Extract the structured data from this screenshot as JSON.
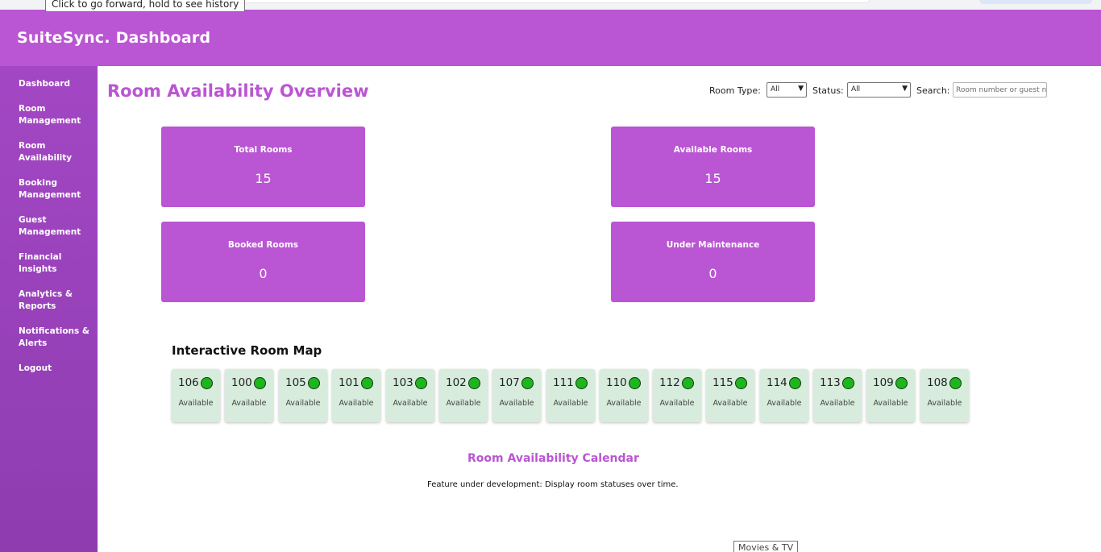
{
  "browser": {
    "tooltip": "Click to go forward, hold to see history"
  },
  "header": {
    "title": "SuiteSync. Dashboard"
  },
  "sidebar": {
    "items": [
      {
        "label": "Dashboard"
      },
      {
        "label": "Room Management"
      },
      {
        "label": "Room Availability"
      },
      {
        "label": "Booking Management"
      },
      {
        "label": "Guest Management"
      },
      {
        "label": "Financial Insights"
      },
      {
        "label": "Analytics & Reports"
      },
      {
        "label": "Notifications & Alerts"
      },
      {
        "label": "Logout"
      }
    ]
  },
  "main": {
    "title": "Room Availability Overview",
    "filters": {
      "room_type_label": "Room Type:",
      "room_type_value": "All",
      "status_label": "Status:",
      "status_value": "All",
      "search_label": "Search:",
      "search_placeholder": "Room number or guest name"
    },
    "stats": [
      {
        "label": "Total Rooms",
        "value": "15"
      },
      {
        "label": "Available Rooms",
        "value": "15"
      },
      {
        "label": "Booked Rooms",
        "value": "0"
      },
      {
        "label": "Under Maintenance",
        "value": "0"
      }
    ],
    "room_map": {
      "title": "Interactive Room Map",
      "rooms": [
        {
          "number": "106",
          "status": "Available"
        },
        {
          "number": "100",
          "status": "Available"
        },
        {
          "number": "105",
          "status": "Available"
        },
        {
          "number": "101",
          "status": "Available"
        },
        {
          "number": "103",
          "status": "Available"
        },
        {
          "number": "102",
          "status": "Available"
        },
        {
          "number": "107",
          "status": "Available"
        },
        {
          "number": "111",
          "status": "Available"
        },
        {
          "number": "110",
          "status": "Available"
        },
        {
          "number": "112",
          "status": "Available"
        },
        {
          "number": "115",
          "status": "Available"
        },
        {
          "number": "114",
          "status": "Available"
        },
        {
          "number": "113",
          "status": "Available"
        },
        {
          "number": "109",
          "status": "Available"
        },
        {
          "number": "108",
          "status": "Available"
        }
      ]
    },
    "calendar": {
      "title": "Room Availability Calendar",
      "note": "Feature under development: Display room statuses over time."
    }
  },
  "taskbar": {
    "tab_label": "Movies & TV"
  },
  "colors": {
    "brand": "#ba55d3",
    "sidebar": "#9b44be",
    "available_bg": "#d7ecdc",
    "available_dot": "#1fb51f"
  }
}
